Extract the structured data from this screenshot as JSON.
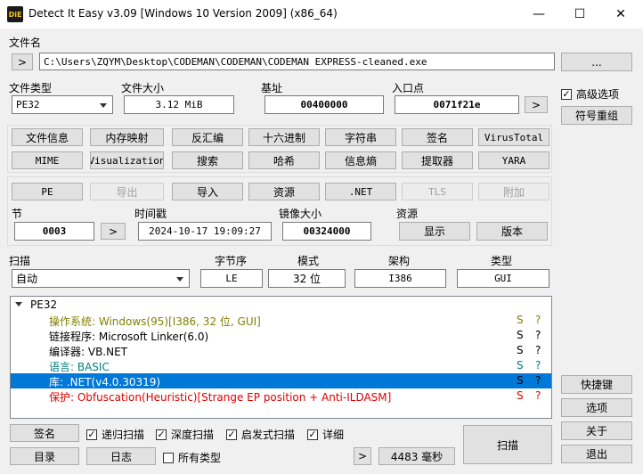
{
  "window": {
    "title": "Detect It Easy v3.09 [Windows 10 Version 2009] (x86_64)",
    "app_icon_text": "DiE",
    "minimize": "—",
    "maximize": "☐",
    "close": "✕"
  },
  "file": {
    "label": "文件名",
    "open_button": ">",
    "path": "C:\\Users\\ZQYM\\Desktop\\CODEMAN\\CODEMAN\\CODEMAN EXPRESS-cleaned.exe",
    "browse_button": "..."
  },
  "info": {
    "type_label": "文件类型",
    "type_value": "PE32",
    "size_label": "文件大小",
    "size_value": "3.12 MiB",
    "base_label": "基址",
    "base_value": "00400000",
    "entry_label": "入口点",
    "entry_value": "0071f21e",
    "entry_button": ">",
    "advanced_label": "高级选项",
    "advanced_checked": true,
    "symbols_button": "符号重组"
  },
  "toolbar_row1": [
    "文件信息",
    "内存映射",
    "反汇编",
    "十六进制",
    "字符串",
    "签名",
    "VirusTotal"
  ],
  "toolbar_row2": [
    "MIME",
    "Visualization",
    "搜索",
    "哈希",
    "信息熵",
    "提取器",
    "YARA"
  ],
  "pe_row": [
    "PE",
    "导出",
    "导入",
    "资源",
    ".NET",
    "TLS",
    "附加"
  ],
  "sections": {
    "section_label": "节",
    "section_value": "0003",
    "section_button": ">",
    "time_label": "时间戳",
    "time_value": "2024-10-17 19:09:27",
    "image_label": "镜像大小",
    "image_value": "00324000",
    "res_label": "资源",
    "show_button": "显示",
    "version_button": "版本"
  },
  "scan": {
    "label": "扫描",
    "mode_value": "自动",
    "endian_label": "字节序",
    "endian_value": "LE",
    "mode_label": "模式",
    "bits_value": "32 位",
    "arch_label": "架构",
    "arch_value": "I386",
    "type_label": "类型",
    "type_value": "GUI"
  },
  "results": {
    "root": "PE32",
    "rows": [
      {
        "text": "操作系统: Windows(95)[I386, 32 位, GUI]",
        "s": "S",
        "q": "?",
        "color": "#808000"
      },
      {
        "text": "链接程序: Microsoft Linker(6.0)",
        "s": "S",
        "q": "?",
        "color": "#000000"
      },
      {
        "text": "编译器: VB.NET",
        "s": "S",
        "q": "?",
        "color": "#000000"
      },
      {
        "text": "语言: BASIC",
        "s": "S",
        "q": "?",
        "color": "#008080"
      },
      {
        "text": "库: .NET(v4.0.30319)",
        "s": "S",
        "q": "?",
        "color": "#ffffff",
        "selected": true
      },
      {
        "text": "保护: Obfuscation(Heuristic)[Strange EP position + Anti-ILDASM]",
        "s": "S",
        "q": "?",
        "color": "#e00000"
      }
    ]
  },
  "right_panel": {
    "shortcuts": "快捷键",
    "options": "选项",
    "about": "关于",
    "exit": "退出"
  },
  "bottom": {
    "signatures": "签名",
    "recursive": "递归扫描",
    "deep": "深度扫描",
    "heuristic": "启发式扫描",
    "verbose": "详细",
    "log": "目录",
    "journal": "日志",
    "all_types": "所有类型",
    "next": ">",
    "time": "4483 毫秒",
    "scan": "扫描"
  }
}
